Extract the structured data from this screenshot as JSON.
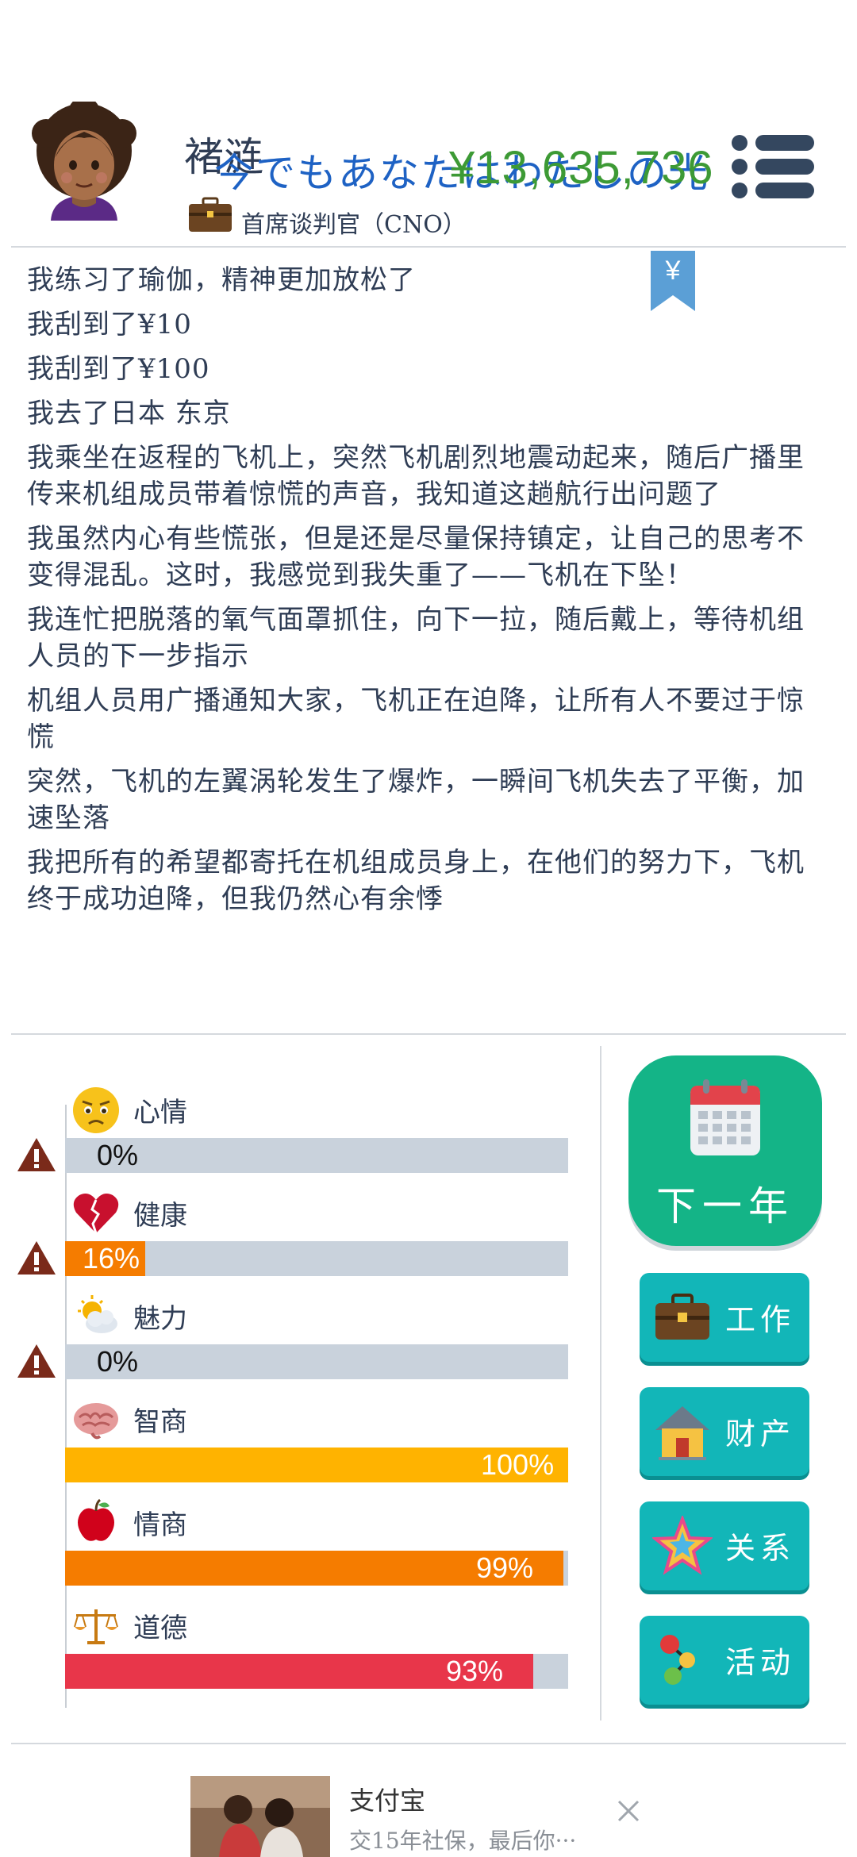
{
  "header": {
    "player_name": "褚涟",
    "overlay_text": "今でもあなたはわたしの光",
    "money": "¥13,635,736",
    "job_title": "首席谈判官（CNO）"
  },
  "log": [
    "我练习了瑜伽，精神更加放松了",
    "我刮到了¥10",
    "我刮到了¥100",
    "我去了日本 东京",
    "我乘坐在返程的飞机上，突然飞机剧烈地震动起来，随后广播里传来机组成员带着惊慌的声音，我知道这趟航行出问题了",
    "我虽然内心有些慌张，但是还是尽量保持镇定，让自己的思考不变得混乱。这时，我感觉到我失重了——飞机在下坠！",
    "我连忙把脱落的氧气面罩抓住，向下一拉，随后戴上，等待机组人员的下一步指示",
    "机组人员用广播通知大家，飞机正在迫降，让所有人不要过于惊慌",
    "突然，飞机的左翼涡轮发生了爆炸，一瞬间飞机失去了平衡，加速坠落",
    "我把所有的希望都寄托在机组成员身上，在他们的努力下，飞机终于成功迫降，但我仍然心有余悸"
  ],
  "bookmark_symbol": "¥",
  "stats": [
    {
      "label": "心情",
      "value": 0,
      "text": "0%",
      "icon": "worried-face-icon",
      "color": "#f57c00",
      "warning": true
    },
    {
      "label": "健康",
      "value": 16,
      "text": "16%",
      "icon": "broken-heart-icon",
      "color": "#f57c00",
      "warning": true
    },
    {
      "label": "魅力",
      "value": 0,
      "text": "0%",
      "icon": "sun-cloud-icon",
      "color": "#f57c00",
      "warning": true
    },
    {
      "label": "智商",
      "value": 100,
      "text": "100%",
      "icon": "brain-icon",
      "color": "#ffb300",
      "warning": false
    },
    {
      "label": "情商",
      "value": 99,
      "text": "99%",
      "icon": "apple-icon",
      "color": "#f57c00",
      "warning": false
    },
    {
      "label": "道德",
      "value": 93,
      "text": "93%",
      "icon": "scales-icon",
      "color": "#e8364a",
      "warning": false
    }
  ],
  "buttons": {
    "next_year": "下一年",
    "work": "工作",
    "property": "财产",
    "relations": "关系",
    "activity": "活动"
  },
  "ad": {
    "title": "支付宝",
    "desc": "交15年社保，最后你···"
  }
}
